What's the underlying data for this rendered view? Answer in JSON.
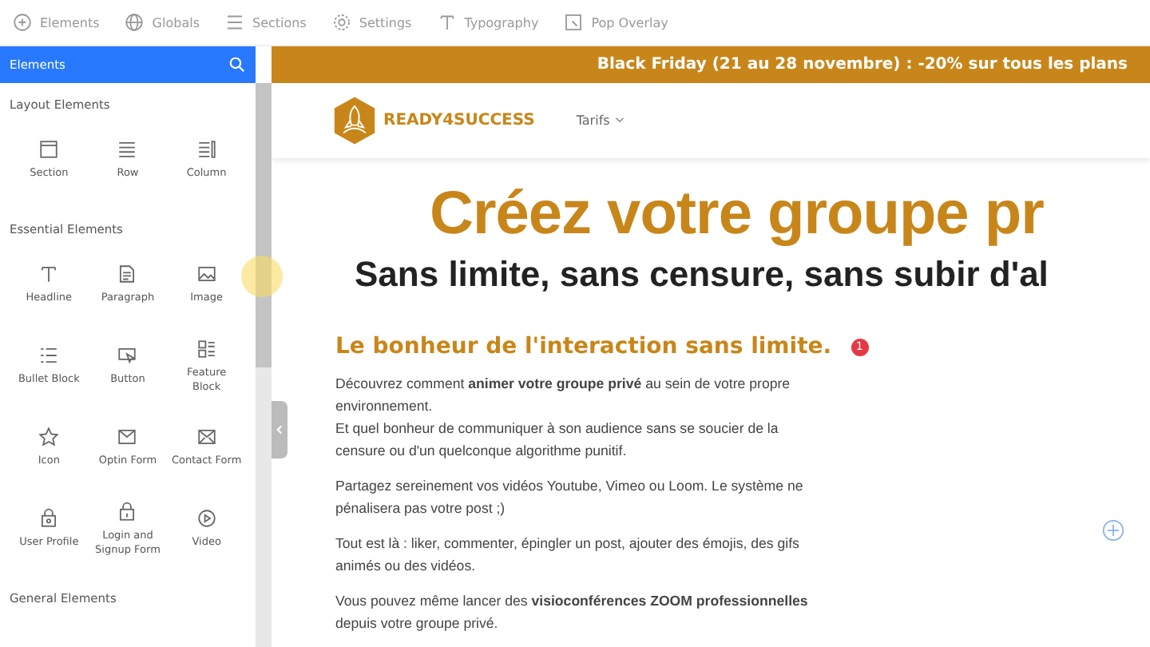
{
  "toolbar": [
    {
      "label": "Elements"
    },
    {
      "label": "Globals"
    },
    {
      "label": "Sections"
    },
    {
      "label": "Settings"
    },
    {
      "label": "Typography"
    },
    {
      "label": "Pop Overlay"
    }
  ],
  "sidebar": {
    "title": "Elements",
    "groups": [
      {
        "title": "Layout Elements",
        "items": [
          {
            "label": "Section",
            "kind": "section"
          },
          {
            "label": "Row",
            "kind": "row"
          },
          {
            "label": "Column",
            "kind": "column"
          }
        ]
      },
      {
        "title": "Essential Elements",
        "items": [
          {
            "label": "Headline",
            "kind": "headline"
          },
          {
            "label": "Paragraph",
            "kind": "paragraph"
          },
          {
            "label": "Image",
            "kind": "image"
          },
          {
            "label": "Bullet Block",
            "kind": "bullet"
          },
          {
            "label": "Button",
            "kind": "button"
          },
          {
            "label": "Feature Block",
            "kind": "feature"
          },
          {
            "label": "Icon",
            "kind": "icon"
          },
          {
            "label": "Optin Form",
            "kind": "optin"
          },
          {
            "label": "Contact Form",
            "kind": "contact"
          },
          {
            "label": "User Profile",
            "kind": "profile"
          },
          {
            "label": "Login and Signup Form",
            "kind": "login"
          },
          {
            "label": "Video",
            "kind": "video"
          }
        ]
      },
      {
        "title": "General Elements"
      }
    ]
  },
  "page": {
    "banner": "Black Friday (21 au 28 novembre) : -20% sur tous les plans",
    "brand": "READY4SUCCESS",
    "nav": [
      "Tarifs"
    ],
    "title": "Créez votre groupe pr",
    "subtitle": "Sans limite, sans censure, sans subir d'al",
    "section_title": "Le bonheur de l'interaction sans limite.",
    "badge": "1",
    "paragraphs": [
      {
        "lines": [
          "Découvrez comment **animer votre groupe privé** au sein de votre propre environnement.",
          "Et quel bonheur de communiquer à son audience sans se soucier de la censure ou d'un quelconque algorithme punitif."
        ]
      },
      {
        "lines": [
          "Partagez sereinement vos vidéos Youtube, Vimeo ou Loom. Le système ne pénalisera pas votre post ;)"
        ]
      },
      {
        "lines": [
          "Tout est là : liker, commenter, épingler un post, ajouter des émojis, des gifs animés ou des vidéos."
        ]
      },
      {
        "lines": [
          "Vous pouvez même lancer des **visioconférences ZOOM professionnelles** depuis votre groupe privé."
        ]
      }
    ]
  }
}
